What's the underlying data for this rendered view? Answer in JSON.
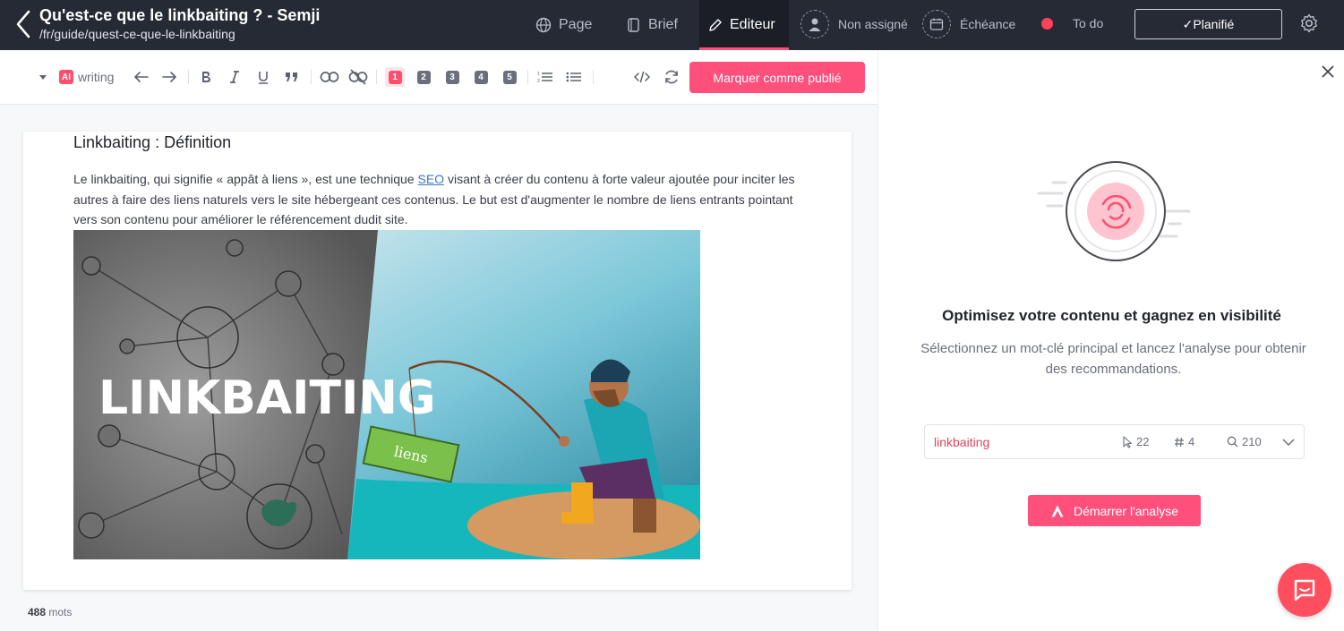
{
  "header": {
    "title": "Qu'est-ce que le linkbaiting ? - Semji",
    "subtitle": "/fr/guide/quest-ce-que-le-linkbaiting",
    "tabs": [
      {
        "label": "Page",
        "icon": "globe-icon"
      },
      {
        "label": "Brief",
        "icon": "brief-icon"
      },
      {
        "label": "Editeur",
        "icon": "pencil-icon",
        "active": true
      }
    ],
    "assignee": "Non assigné",
    "due_date": "Échéance",
    "status": "To do",
    "status_color": "#ff4257",
    "planned_button": "✓Planifié"
  },
  "toolbar": {
    "ai_badge": "AI",
    "ai_label": "writing",
    "headings": [
      "1",
      "2",
      "3",
      "4",
      "5"
    ],
    "active_heading": "1",
    "publish_button": "Marquer comme publié"
  },
  "document": {
    "heading": "Linkbaiting : Définition",
    "paragraph_before_link": "Le linkbaiting, qui signifie « appât à liens », est une technique ",
    "paragraph_link": "SEO",
    "paragraph_after_link": " visant à créer du contenu à forte valeur ajoutée pour inciter les autres à faire des liens naturels vers le site hébergeant ces contenus. Le but est d'augmenter le nombre de liens entrants pointant vers son contenu pour améliorer le référencement dudit site.",
    "image_title": "LINKBAITING",
    "image_sign": "liens",
    "word_count": "488",
    "word_count_label": "mots"
  },
  "side": {
    "title": "Optimisez votre contenu et gagnez en visibilité",
    "description": "Sélectionnez un mot-clé principal et lancez l'analyse pour obtenir des recommandations.",
    "keyword": "linkbaiting",
    "stats": {
      "clicks": "22",
      "position": "4",
      "volume": "210"
    },
    "analyse_button": "Démarrer l'analyse"
  },
  "colors": {
    "accent": "#ff4f7b",
    "topbar": "#262a35",
    "keyword": "#e0455e"
  }
}
